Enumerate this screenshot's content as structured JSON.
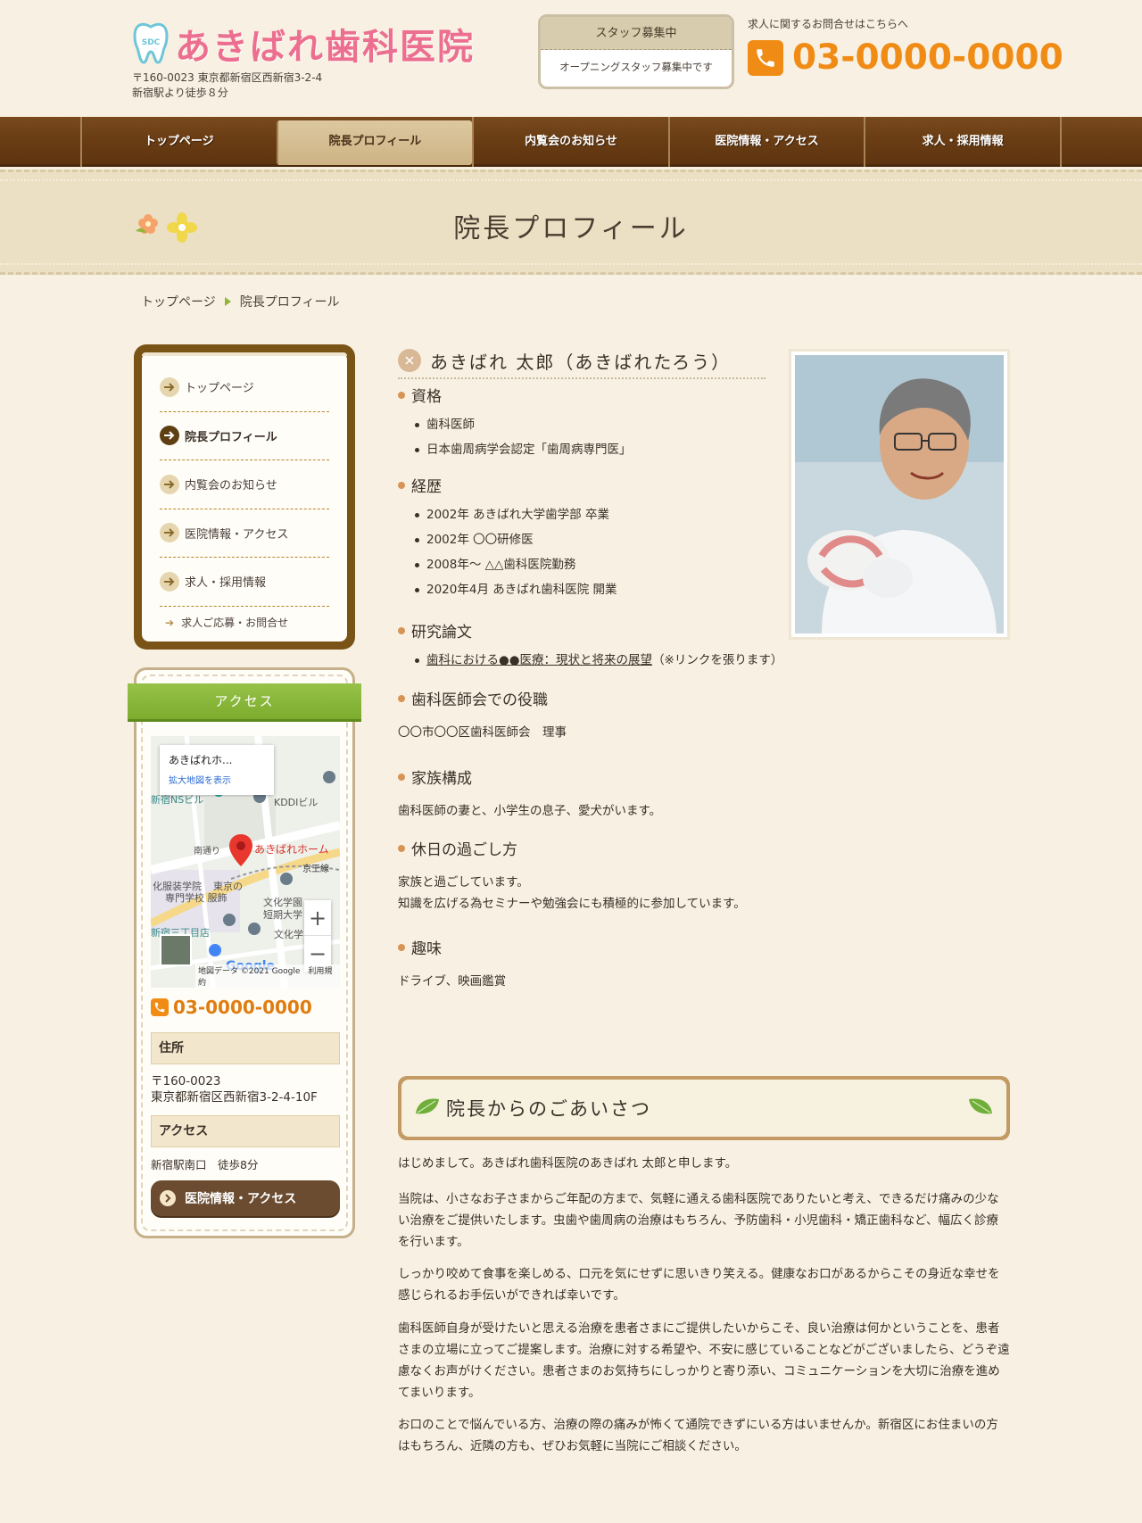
{
  "header": {
    "logo_badge": "SDC",
    "clinic_name": "あきばれ歯科医院",
    "address_line1": "〒160-0023 東京都新宿区西新宿3-2-4",
    "address_line2": "新宿駅より徒歩８分",
    "staff_box": {
      "title": "スタッフ募集中",
      "body": "オープニングスタッフ募集中です"
    },
    "tel_note": "求人に関するお問合せはこちらへ",
    "tel_number": "03-0000-0000",
    "accent_color": "#f08c16",
    "logo_color": "#ec6f8f"
  },
  "nav": {
    "items": [
      {
        "label": "トップページ"
      },
      {
        "label": "院長プロフィール"
      },
      {
        "label": "内覧会のお知らせ"
      },
      {
        "label": "医院情報・アクセス"
      },
      {
        "label": "求人・採用情報"
      }
    ],
    "active_index": 1
  },
  "page_title": "院長プロフィール",
  "breadcrumb": {
    "home": "トップページ",
    "current": "院長プロフィール"
  },
  "side_menu": {
    "items": [
      {
        "label": "トップページ"
      },
      {
        "label": "院長プロフィール"
      },
      {
        "label": "内覧会のお知らせ"
      },
      {
        "label": "医院情報・アクセス"
      },
      {
        "label": "求人・採用情報"
      }
    ],
    "sub_item": "求人ご応募・お問合せ"
  },
  "access": {
    "title": "アクセス",
    "map": {
      "popup_title": "あきばれホ...",
      "popup_link": "拡大地図を表示",
      "credit": "地図データ ©2021 Google　利用規約",
      "brand": "Google",
      "marker_label": "あきばれホーム",
      "labels": [
        "新宿NSビル",
        "KDDIビル",
        "南通り",
        "京王線",
        "化服装学院",
        "東京の",
        "専門学校 服飾",
        "文化学園",
        "短期大学",
        "新宿三丁目店",
        "文化学"
      ],
      "zoom_in": "+",
      "zoom_out": "−"
    },
    "tel": "03-0000-0000",
    "address_label": "住所",
    "address_line1": "〒160-0023",
    "address_line2": "東京都新宿区西新宿3-2-4-10F",
    "access_label": "アクセス",
    "access_text": "新宿駅南口　徒歩8分",
    "button": "医院情報・アクセス",
    "ribbon_color": "#8ab83e"
  },
  "profile": {
    "name": "あきばれ 太郎（あきばれたろう）",
    "sections": {
      "qualifications": {
        "title": "資格",
        "items": [
          "歯科医師",
          "日本歯周病学会認定「歯周病専門医」"
        ]
      },
      "career": {
        "title": "経歴",
        "items": [
          "2002年 あきばれ大学歯学部 卒業",
          "2002年 〇〇研修医",
          "2008年～ △△歯科医院勤務",
          "2020年4月 あきばれ歯科医院 開業"
        ]
      },
      "papers": {
        "title": "研究論文",
        "link": "歯科における●●医療：現状と将来の展望",
        "note": "（※リンクを張ります）"
      },
      "role": {
        "title": "歯科医師会での役職",
        "text": "〇〇市〇〇区歯科医師会　理事"
      },
      "family": {
        "title": "家族構成",
        "text": "歯科医師の妻と、小学生の息子、愛犬がいます。"
      },
      "holiday": {
        "title": "休日の過ごし方",
        "line1": "家族と過ごしています。",
        "line2": "知識を広げる為セミナーや勉強会にも積極的に参加しています。"
      },
      "hobby": {
        "title": "趣味",
        "text": "ドライブ、映画鑑賞"
      }
    }
  },
  "greeting": {
    "title": "院長からのごあいさつ",
    "paragraphs": [
      "はじめまして。あきばれ歯科医院のあきばれ 太郎と申します。",
      "当院は、小さなお子さまからご年配の方まで、気軽に通える歯科医院でありたいと考え、できるだけ痛みの少ない治療をご提供いたします。虫歯や歯周病の治療はもちろん、予防歯科・小児歯科・矯正歯科など、幅広く診療を行います。",
      "しっかり咬めて食事を楽しめる、口元を気にせずに思いきり笑える。健康なお口があるからこその身近な幸せを感じられるお手伝いができれば幸いです。",
      "歯科医師自身が受けたいと思える治療を患者さまにご提供したいからこそ、良い治療は何かということを、患者さまの立場に立ってご提案します。治療に対する希望や、不安に感じていることなどがございましたら、どうぞ遠慮なくお声がけください。患者さまのお気持ちにしっかりと寄り添い、コミュニケーションを大切に治療を進めてまいります。",
      "お口のことで悩んでいる方、治療の際の痛みが怖くて通院できずにいる方はいませんか。新宿区にお住まいの方はもちろん、近隣の方も、ぜひお気軽に当院にご相談ください。"
    ]
  }
}
